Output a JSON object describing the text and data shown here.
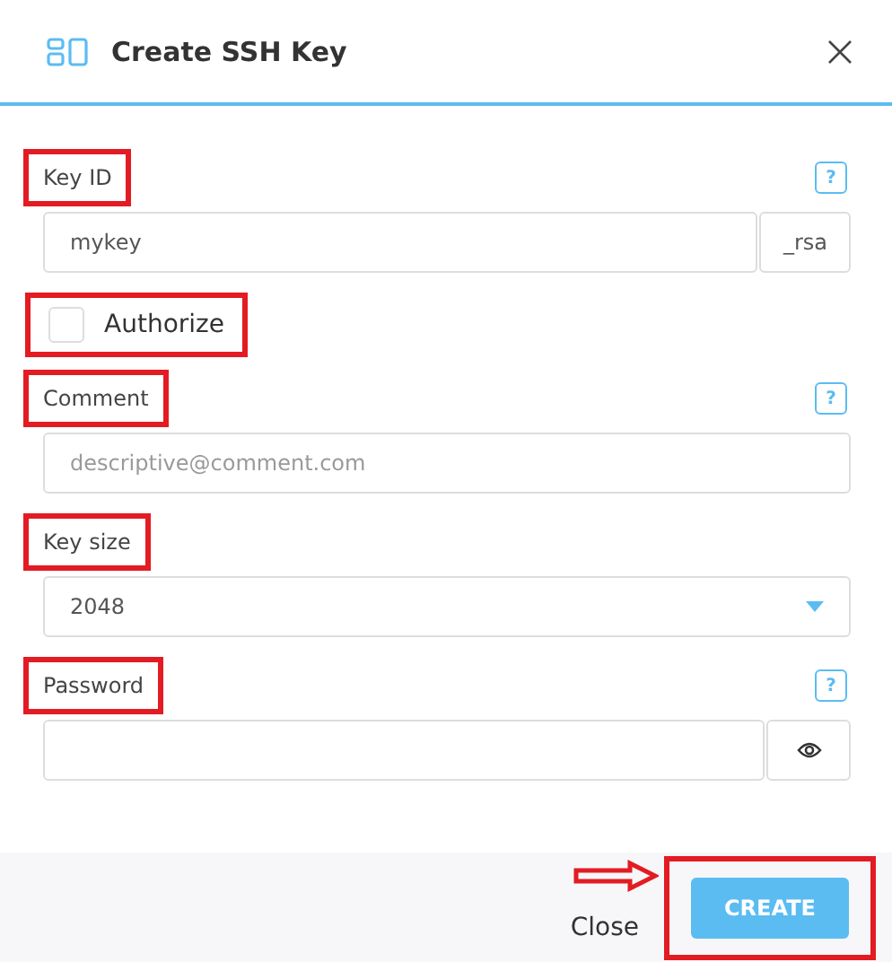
{
  "dialog": {
    "title": "Create SSH Key"
  },
  "fields": [
    {
      "kind": "suffix",
      "label": "Key ID",
      "highlighted": true,
      "help": "?",
      "value": "mykey",
      "suffix": "_rsa"
    },
    {
      "kind": "checkbox",
      "label": "Authorize",
      "highlighted": true,
      "checked": false
    },
    {
      "kind": "text",
      "label": "Comment",
      "highlighted": true,
      "help": "?",
      "placeholder": "descriptive@comment.com"
    },
    {
      "kind": "select",
      "label": "Key size",
      "highlighted": true,
      "value": "2048"
    },
    {
      "kind": "password",
      "label": "Password",
      "highlighted": true,
      "help": "?"
    }
  ],
  "footer": {
    "close": "Close",
    "create": "CREATE",
    "create_highlighted": true,
    "arrow": true
  }
}
